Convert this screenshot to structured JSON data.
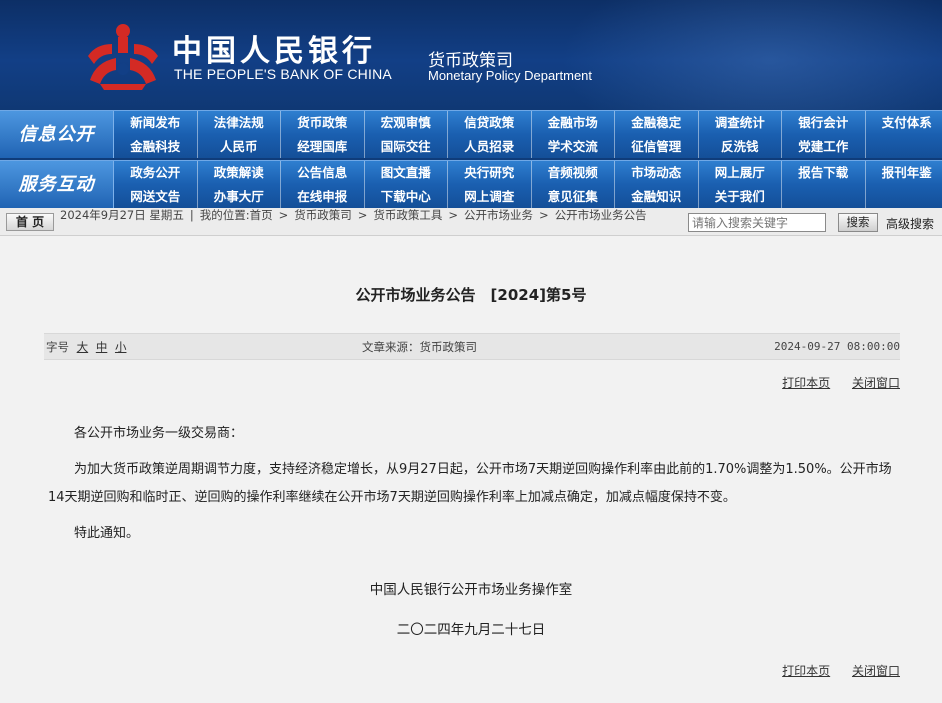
{
  "header": {
    "bank_name_cn": "中国人民银行",
    "bank_name_en": "THE PEOPLE'S BANK OF CHINA",
    "dept_cn": "货币政策司",
    "dept_en": "Monetary Policy Department",
    "logo_icon": "pboc-logo-icon",
    "colors": {
      "banner": "#123f86",
      "nav": "#1a5fb0",
      "logo": "#d42a24"
    }
  },
  "nav": {
    "info": {
      "title": "信息公开",
      "items": [
        "新闻发布",
        "法律法规",
        "货币政策",
        "宏观审慎",
        "信贷政策",
        "金融市场",
        "金融稳定",
        "调查统计",
        "银行会计",
        "支付体系",
        "金融科技",
        "人民币",
        "经理国库",
        "国际交往",
        "人员招录",
        "学术交流",
        "征信管理",
        "反洗钱",
        "党建工作",
        ""
      ]
    },
    "service": {
      "title": "服务互动",
      "items": [
        "政务公开",
        "政策解读",
        "公告信息",
        "图文直播",
        "央行研究",
        "音频视频",
        "市场动态",
        "网上展厅",
        "报告下载",
        "报刊年鉴",
        "网送文告",
        "办事大厅",
        "在线申报",
        "下载中心",
        "网上调查",
        "意见征集",
        "金融知识",
        "关于我们",
        "",
        ""
      ]
    }
  },
  "breadcrumb": {
    "home": "首 页",
    "text_parts": [
      "2024年9月27日 星期五",
      "|",
      "我的位置:首页",
      ">",
      "货币政策司",
      ">",
      "货币政策工具",
      ">",
      "公开市场业务",
      ">",
      "公开市场业务公告"
    ]
  },
  "search": {
    "placeholder": "请输入搜索关键字",
    "button": "搜索",
    "advanced": "高级搜索"
  },
  "article": {
    "title": "公开市场业务公告　[2024]第5号",
    "font_label": "字号",
    "font_sizes": [
      "大",
      "中",
      "小"
    ],
    "source": "文章来源：货币政策司",
    "date": "2024-09-27 08:00:00",
    "print": "打印本页",
    "close": "关闭窗口",
    "paragraphs": [
      "各公开市场业务一级交易商：",
      "为加大货币政策逆周期调节力度，支持经济稳定增长，从9月27日起，公开市场7天期逆回购操作利率由此前的1.70%调整为1.50%。公开市场14天期逆回购和临时正、逆回购的操作利率继续在公开市场7天期逆回购操作利率上加减点确定，加减点幅度保持不变。",
      "特此通知。"
    ],
    "sign_org": "中国人民银行公开市场业务操作室",
    "sign_date": "二〇二四年九月二十七日"
  }
}
